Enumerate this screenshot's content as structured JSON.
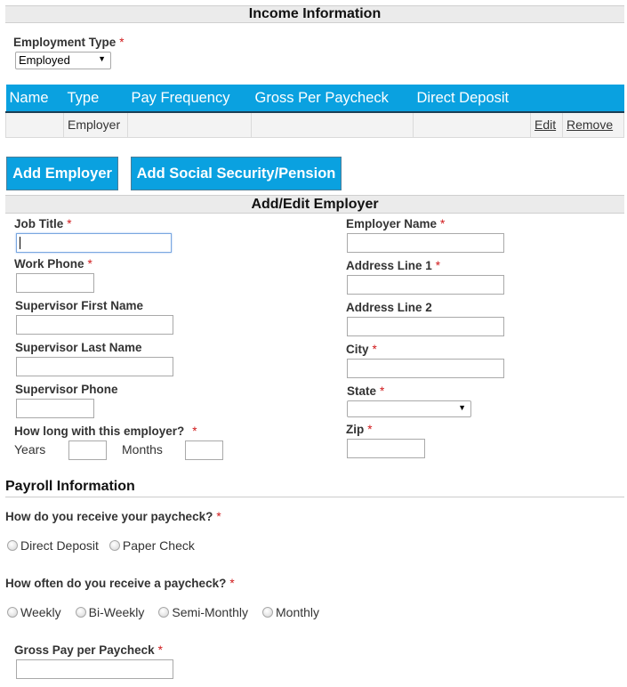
{
  "income_section": {
    "title": "Income Information",
    "employment_type": {
      "label": "Employment Type",
      "required_mark": "*",
      "selected": "Employed",
      "arrow_icon": "▼"
    }
  },
  "employer_table": {
    "columns": [
      "Name",
      "Type",
      "Pay Frequency",
      "Gross Per Paycheck",
      "Direct Deposit",
      "",
      ""
    ],
    "rows": [
      {
        "name": "",
        "type": "Employer",
        "pay_frequency": "",
        "gross_per_paycheck": "",
        "direct_deposit": "",
        "edit_label": "Edit",
        "remove_label": "Remove"
      }
    ],
    "header_color": "#0aa1e0"
  },
  "buttons": {
    "add_employer": "Add Employer",
    "add_social_security": "Add Social Security/Pension",
    "button_color": "#0aa1e0"
  },
  "add_edit_section": {
    "title": "Add/Edit Employer",
    "left_fields": {
      "job_title": {
        "label": "Job Title",
        "required_mark": "*",
        "value": ""
      },
      "work_phone": {
        "label": "Work Phone",
        "required_mark": "*",
        "value": ""
      },
      "supervisor_first_name": {
        "label": "Supervisor First Name",
        "value": ""
      },
      "supervisor_last_name": {
        "label": "Supervisor Last Name",
        "value": ""
      },
      "supervisor_phone": {
        "label": "Supervisor Phone",
        "value": ""
      },
      "tenure": {
        "label": "How long with this employer?",
        "required_mark": "*",
        "years_label": "Years",
        "months_label": "Months",
        "years_value": "",
        "months_value": ""
      }
    },
    "right_fields": {
      "employer_name": {
        "label": "Employer Name",
        "required_mark": "*",
        "value": ""
      },
      "address_line_1": {
        "label": "Address Line 1",
        "required_mark": "*",
        "value": ""
      },
      "address_line_2": {
        "label": "Address Line 2",
        "value": ""
      },
      "city": {
        "label": "City",
        "required_mark": "*",
        "value": ""
      },
      "state": {
        "label": "State",
        "required_mark": "*",
        "selected": "",
        "arrow_icon": "▼"
      },
      "zip": {
        "label": "Zip",
        "required_mark": "*",
        "value": ""
      }
    }
  },
  "payroll_section": {
    "title": "Payroll Information",
    "receive_question": {
      "label": "How do you receive your paycheck?",
      "required_mark": "*",
      "options": [
        "Direct Deposit",
        "Paper Check"
      ]
    },
    "frequency_question": {
      "label": "How often do you receive a paycheck?",
      "required_mark": "*",
      "options": [
        "Weekly",
        "Bi-Weekly",
        "Semi-Monthly",
        "Monthly"
      ]
    },
    "gross_pay": {
      "label": "Gross Pay per Paycheck",
      "required_mark": "*",
      "value": ""
    }
  }
}
